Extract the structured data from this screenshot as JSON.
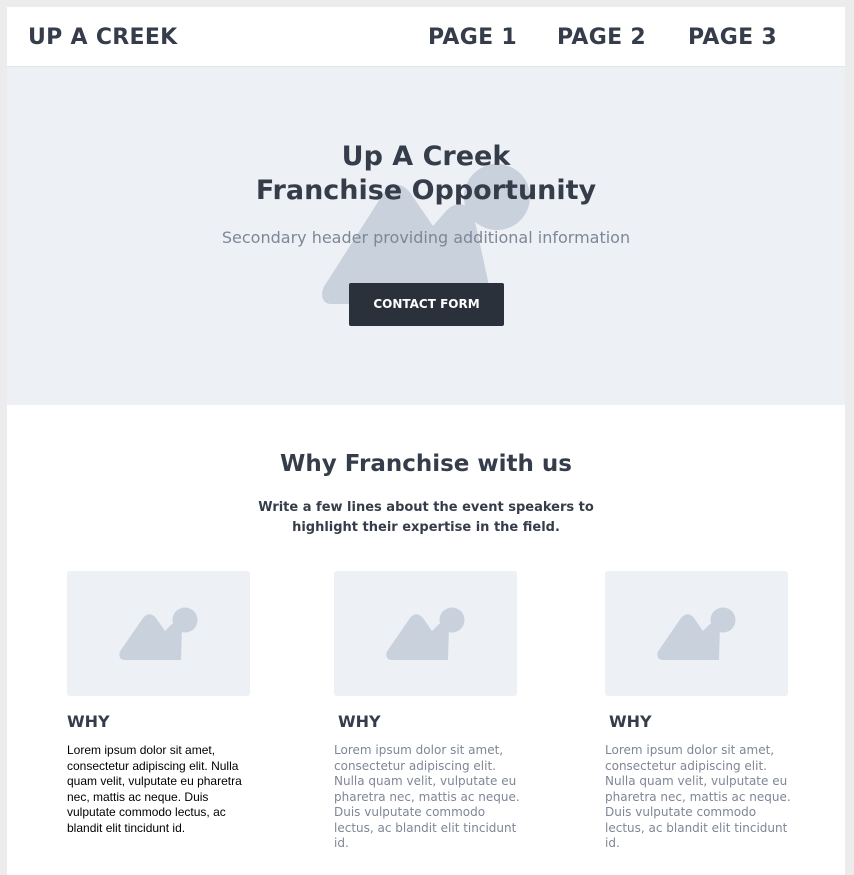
{
  "header": {
    "brand": "UP A CREEK",
    "nav": [
      "PAGE 1",
      "PAGE 2",
      "PAGE 3"
    ]
  },
  "hero": {
    "title_line1": "Up A Creek",
    "title_line2": "Franchise Opportunity",
    "subtitle": "Secondary header providing additional information",
    "cta_label": "CONTACT FORM",
    "image_icon": "image-placeholder-icon"
  },
  "features": {
    "title": "Why Franchise with us",
    "description": "Write a few lines about the event speakers to highlight their expertise in the field.",
    "cards": [
      {
        "title": "WHY",
        "text": "Lorem ipsum dolor sit amet, consectetur adipiscing elit. Nulla quam velit, vulputate eu pharetra nec, mattis ac neque. Duis vulputate commodo lectus, ac blandit elit tincidunt id."
      },
      {
        "title": "WHY",
        "text": "Lorem ipsum dolor sit amet, consectetur adipiscing elit. Nulla quam velit, vulputate eu pharetra nec, mattis ac neque. Duis vulputate commodo lectus, ac blandit elit tincidunt id."
      },
      {
        "title": "WHY",
        "text": "Lorem ipsum dolor sit amet, consectetur adipiscing elit. Nulla quam velit, vulputate eu pharetra nec, mattis ac neque. Duis vulputate commodo lectus, ac blandit elit tincidunt id."
      }
    ]
  },
  "colors": {
    "text_dark": "#363d4a",
    "text_muted": "#7e8796",
    "hero_bg": "#edf0f4",
    "button_bg": "#2b313b",
    "placeholder_shape": "#c8d1dc"
  }
}
